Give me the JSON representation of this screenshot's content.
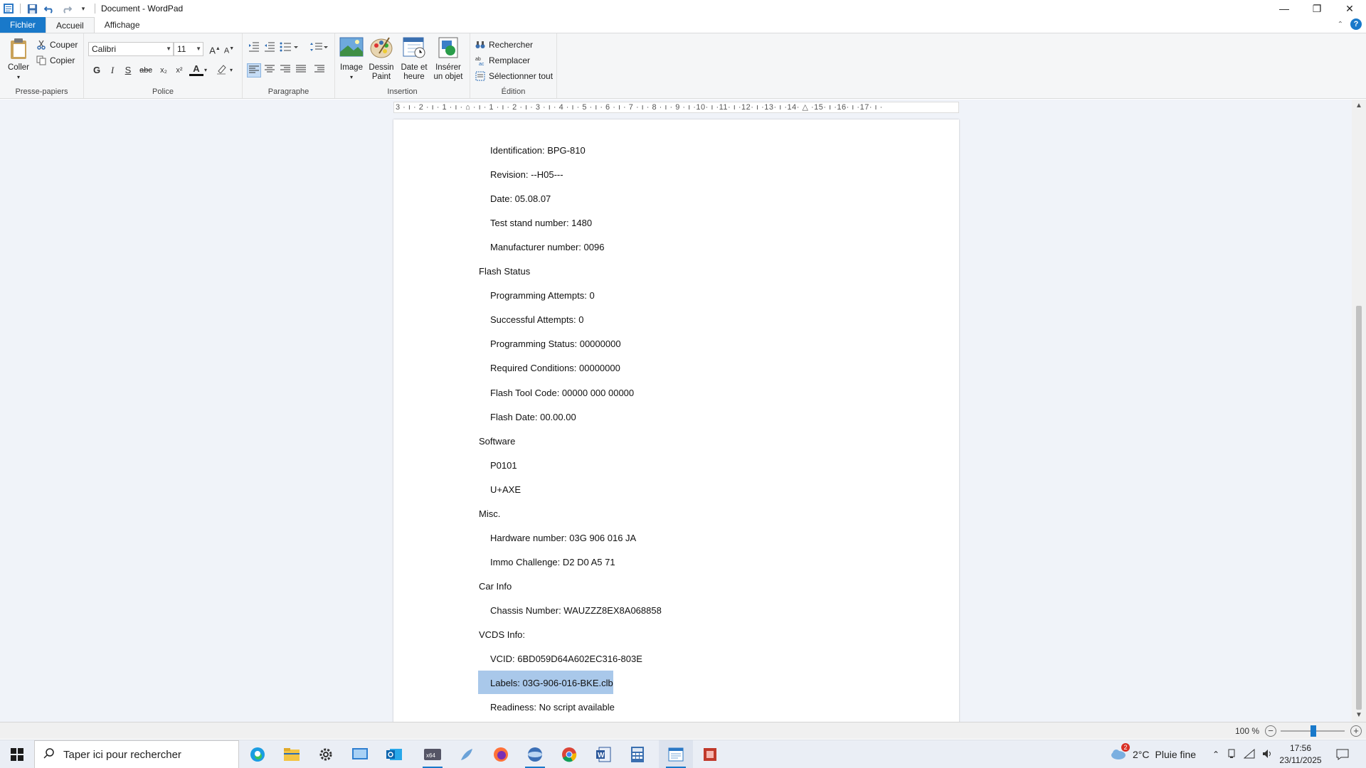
{
  "window": {
    "title": "Document - WordPad"
  },
  "tabs": [
    {
      "label": "Fichier"
    },
    {
      "label": "Accueil"
    },
    {
      "label": "Affichage"
    }
  ],
  "ribbon": {
    "clipboard": {
      "paste": "Coller",
      "cut": "Couper",
      "copy": "Copier",
      "label": "Presse-papiers"
    },
    "font": {
      "family": "Calibri",
      "size": "11",
      "label": "Police",
      "bold": "G",
      "italic": "I",
      "strike": "S",
      "abc": "abc",
      "subscript": "x₂",
      "superscript": "x²",
      "color_letter": "A"
    },
    "paragraph": {
      "label": "Paragraphe"
    },
    "insert": {
      "image": "Image",
      "paint_line1": "Dessin",
      "paint_line2": "Paint",
      "date_line1": "Date et",
      "date_line2": "heure",
      "object_line1": "Insérer",
      "object_line2": "un objet",
      "label": "Insertion"
    },
    "edit": {
      "find": "Rechercher",
      "replace": "Remplacer",
      "select_all": "Sélectionner tout",
      "label": "Édition"
    }
  },
  "ruler": {
    "text": "3 · ı · 2 · ı · 1 · ı · ⌂ · ı · 1 · ı · 2 · ı · 3 · ı · 4 · ı · 5 · ı · 6 · ı · 7 · ı · 8 · ı · 9 · ı ·10· ı ·11· ı ·12· ı ·13· ı ·14· △ ·15· ı ·16· ı ·17· ı ·"
  },
  "document": {
    "lines": [
      {
        "text": "Identification: BPG-810",
        "indent": true
      },
      {
        "text": "Revision: --H05---",
        "indent": true
      },
      {
        "text": "Date: 05.08.07",
        "indent": true
      },
      {
        "text": "Test stand number: 1480",
        "indent": true
      },
      {
        "text": "Manufacturer number: 0096",
        "indent": true
      },
      {
        "text": "Flash Status",
        "indent": false
      },
      {
        "text": "Programming Attempts: 0",
        "indent": true
      },
      {
        "text": "Successful Attempts: 0",
        "indent": true
      },
      {
        "text": "Programming Status: 00000000",
        "indent": true
      },
      {
        "text": "Required Conditions: 00000000",
        "indent": true
      },
      {
        "text": "Flash Tool Code: 00000 000 00000",
        "indent": true
      },
      {
        "text": "Flash Date: 00.00.00",
        "indent": true
      },
      {
        "text": "Software",
        "indent": false
      },
      {
        "text": "P0101",
        "indent": true
      },
      {
        "text": "U+AXE",
        "indent": true
      },
      {
        "text": "Misc.",
        "indent": false
      },
      {
        "text": "Hardware number: 03G 906 016  JA",
        "indent": true
      },
      {
        "text": "Immo Challenge: D2 D0 A5 71",
        "indent": true
      },
      {
        "text": "Car Info",
        "indent": false
      },
      {
        "text": "Chassis Number: WAUZZZ8EX8A068858",
        "indent": true
      },
      {
        "text": "VCDS Info:",
        "indent": false
      },
      {
        "text": "VCID: 6BD059D64A602EC316-803E",
        "indent": true
      },
      {
        "text": "Labels: 03G-906-016-BKE.clb",
        "indent": true,
        "selected": true
      },
      {
        "text": "Readiness: No script available",
        "indent": true
      }
    ]
  },
  "statusbar": {
    "zoom": "100 %",
    "zoom_level": 1.0
  },
  "taskbar": {
    "search_placeholder": "Taper ici pour rechercher",
    "weather_temp": "2°C",
    "weather_text": "Pluie fine",
    "weather_badge": "2",
    "time": "17:56",
    "date": "23/11/2025"
  },
  "colors": {
    "accent": "#1979ca",
    "selection": "#a9c8ea",
    "ribbon_bg": "#f5f6f7",
    "doc_bg": "#f0f3f9"
  }
}
